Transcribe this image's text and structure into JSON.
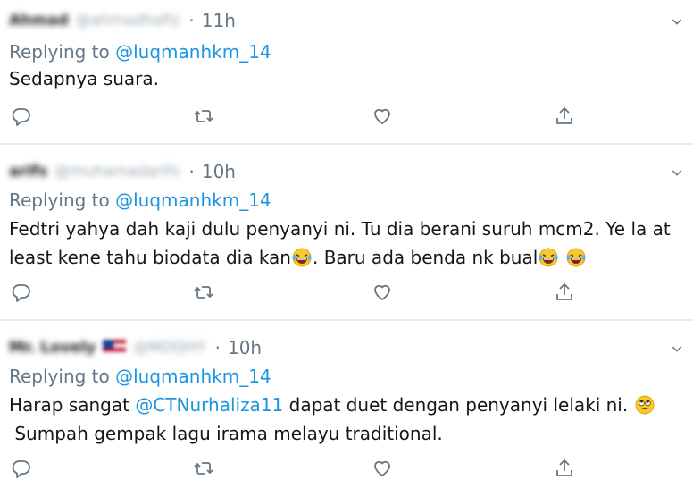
{
  "tweets": [
    {
      "name": "Ahmad",
      "handle": "@ahmadhafiz",
      "flag": false,
      "time": "11h",
      "replying_prefix": "Replying to",
      "replying_handle": "@luqmanhkm_14",
      "text_lines": [
        [
          {
            "t": "text",
            "v": "Sedapnya suara."
          }
        ]
      ]
    },
    {
      "name": "arifs",
      "handle": "@muhamadarifs",
      "flag": false,
      "time": "10h",
      "replying_prefix": "Replying to",
      "replying_handle": "@luqmanhkm_14",
      "text_lines": [
        [
          {
            "t": "text",
            "v": "Fedtri yahya dah kaji dulu penyanyi ni. Tu dia berani suruh mcm2. Ye la at"
          }
        ],
        [
          {
            "t": "text",
            "v": "least kene tahu biodata dia kan"
          },
          {
            "t": "emoji",
            "v": "laughing-tears-emoji"
          },
          {
            "t": "text",
            "v": ". Baru ada benda nk bual"
          },
          {
            "t": "emoji",
            "v": "laughing-tears-emoji"
          },
          {
            "t": "text",
            "v": " "
          },
          {
            "t": "emoji",
            "v": "laughing-tears-emoji"
          }
        ]
      ]
    },
    {
      "name": "Mr. Lovely",
      "handle": "@MDQHY",
      "flag": true,
      "time": "10h",
      "replying_prefix": "Replying to",
      "replying_handle": "@luqmanhkm_14",
      "text_lines": [
        [
          {
            "t": "text",
            "v": "Harap sangat "
          },
          {
            "t": "mention",
            "v": "@CTNurhaliza11"
          },
          {
            "t": "text",
            "v": " dapat duet dengan penyanyi lelaki ni. "
          },
          {
            "t": "emoji",
            "v": "eye-roll-emoji"
          }
        ],
        [
          {
            "t": "text",
            "v": " Sumpah gempak lagu irama melayu traditional."
          }
        ]
      ]
    }
  ],
  "separator": "·",
  "actions": [
    "reply-icon",
    "retweet-icon",
    "like-icon",
    "share-icon"
  ],
  "colors": {
    "link": "#1b95e0",
    "muted": "#657786",
    "divider": "#e6ecf0"
  }
}
